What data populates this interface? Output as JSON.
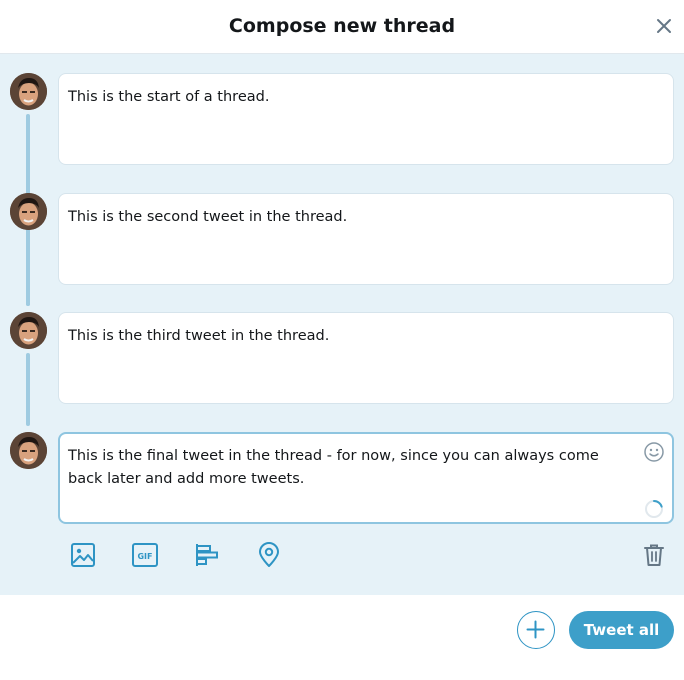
{
  "dialog": {
    "title": "Compose new thread",
    "close_icon": "close-icon"
  },
  "thread": {
    "tweets": [
      {
        "text": "This is the start of a thread."
      },
      {
        "text": "This is the second tweet in the thread."
      },
      {
        "text": "This is the third tweet in the thread."
      },
      {
        "text": "This is the final tweet in the thread - for now, since you can always come back later and add more tweets."
      }
    ]
  },
  "toolbar": {
    "icons": [
      "image-icon",
      "gif-icon",
      "poll-icon",
      "location-icon"
    ],
    "gif_label": "GIF",
    "delete_icon": "trash-icon",
    "emoji_icon": "emoji-icon",
    "char_progress": 0.2
  },
  "footer": {
    "add_icon": "plus-icon",
    "tweet_all_label": "Tweet all"
  },
  "colors": {
    "accent": "#3d9fc9",
    "thread_background": "#e6f2f8",
    "connector": "#9fcbe1"
  }
}
